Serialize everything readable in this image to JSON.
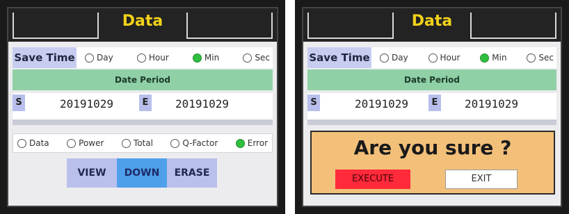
{
  "screens": [
    {
      "title": "Data",
      "save_time_label": "Save Time",
      "save_time_options": [
        {
          "label": "Day",
          "selected": false
        },
        {
          "label": "Hour",
          "selected": false
        },
        {
          "label": "Min",
          "selected": true
        },
        {
          "label": "Sec",
          "selected": false
        }
      ],
      "date_period_label": "Date Period",
      "start_label": "S",
      "start_date": "20191029",
      "end_label": "E",
      "end_date": "20191029",
      "mode_options": [
        {
          "label": "Data",
          "selected": false
        },
        {
          "label": "Power",
          "selected": false
        },
        {
          "label": "Total",
          "selected": false
        },
        {
          "label": "Q-Factor",
          "selected": false
        },
        {
          "label": "Error",
          "selected": true
        }
      ],
      "buttons": [
        "VIEW",
        "DOWN",
        "ERASE"
      ]
    },
    {
      "title": "Data",
      "save_time_label": "Save Time",
      "save_time_options": [
        {
          "label": "Day",
          "selected": false
        },
        {
          "label": "Hour",
          "selected": false
        },
        {
          "label": "Min",
          "selected": true
        },
        {
          "label": "Sec",
          "selected": false
        }
      ],
      "date_period_label": "Date Period",
      "start_label": "S",
      "start_date": "20191029",
      "end_label": "E",
      "end_date": "20191029",
      "confirm_text": "Are you sure ?",
      "execute_label": "EXECUTE",
      "exit_label": "EXIT"
    }
  ],
  "colors": {
    "title": "#f2d21a",
    "radio_selected": "#2fbf3f",
    "date_period_bar": "#8fd0a6",
    "down_button": "#4fa0ea",
    "execute_button": "#ff2a3a",
    "confirm_panel": "#f3c07a"
  }
}
